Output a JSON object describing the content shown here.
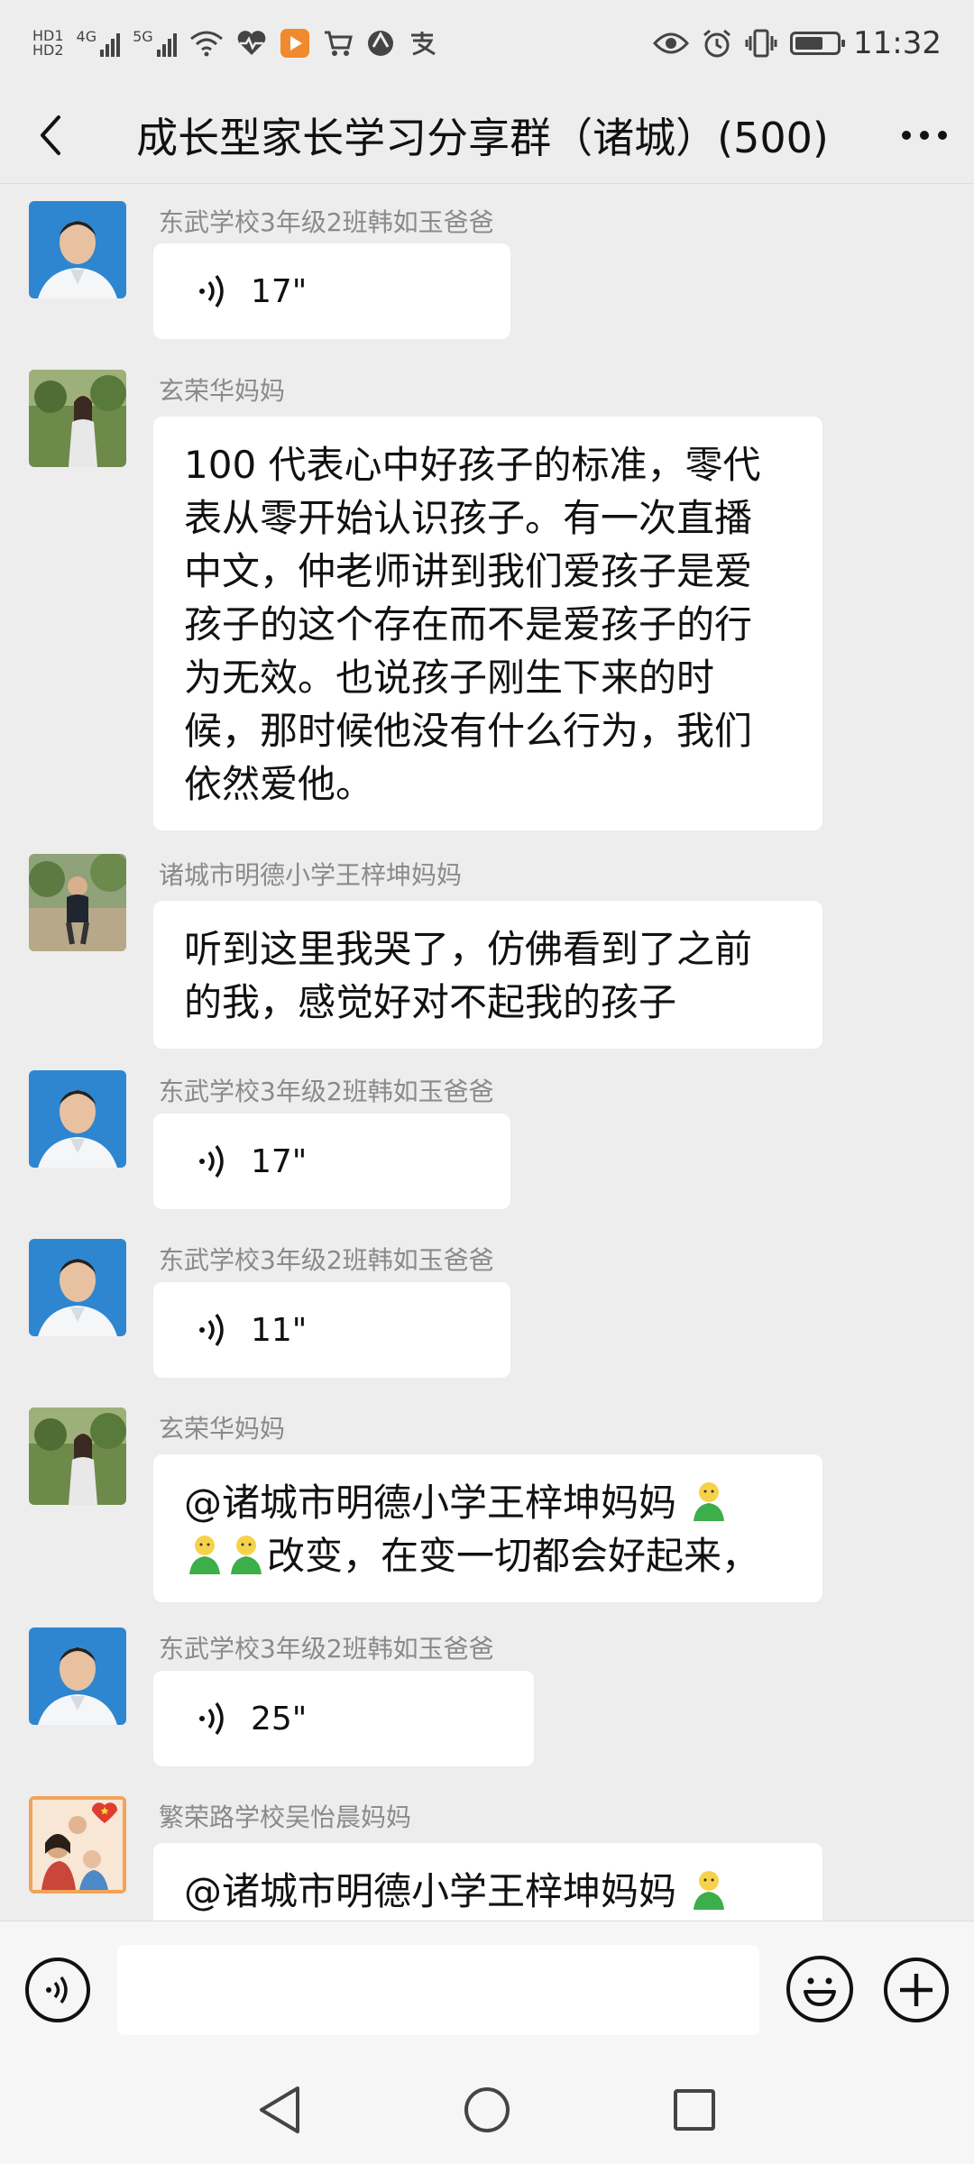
{
  "status_bar": {
    "hd1": "HD1",
    "hd2": "HD2",
    "net1": "4G",
    "net2": "5G",
    "time": "11:32",
    "icons": [
      "hd-icon",
      "signal-icon",
      "wifi-icon",
      "heart-rate-icon",
      "video-app-icon",
      "cart-icon",
      "browser-icon",
      "alipay-icon",
      "eye-icon",
      "alarm-icon",
      "vibrate-icon",
      "battery-icon"
    ]
  },
  "header": {
    "title": "成长型家长学习分享群（诸城）(500)",
    "back_icon": "chevron-left-icon",
    "more_icon": "ellipsis-icon"
  },
  "messages": [
    {
      "sender": "东武学校3年级2班韩如玉爸爸",
      "type": "voice",
      "duration": "17\""
    },
    {
      "sender": "玄荣华妈妈",
      "type": "text",
      "lines": [
        "100 代表心中好孩子的标准，零代",
        "表从零开始认识孩子。有一次直播",
        "中文，仲老师讲到我们爱孩子是爱",
        "孩子的这个存在而不是爱孩子的行",
        "为无效。也说孩子刚生下来的时",
        "候，那时候他没有什么行为，我们",
        "依然爱他。"
      ]
    },
    {
      "sender": "诸城市明德小学王梓坤妈妈",
      "type": "text",
      "lines": [
        "听到这里我哭了，仿佛看到了之前",
        "的我，感觉好对不起我的孩子"
      ]
    },
    {
      "sender": "东武学校3年级2班韩如玉爸爸",
      "type": "voice",
      "duration": "17\""
    },
    {
      "sender": "东武学校3年级2班韩如玉爸爸",
      "type": "voice",
      "duration": "11\""
    },
    {
      "sender": "玄荣华妈妈",
      "type": "text",
      "line1": "@诸城市明德小学王梓坤妈妈",
      "line2": "改变，在变一切都会好起来，"
    },
    {
      "sender": "东武学校3年级2班韩如玉爸爸",
      "type": "voice",
      "duration": "25\""
    },
    {
      "sender": "繁荣路学校吴怡晨妈妈",
      "type": "text",
      "line1": "@诸城市明德小学王梓坤妈妈"
    }
  ],
  "input": {
    "placeholder": "",
    "voice_icon": "voice-toggle-icon",
    "emoji_icon": "smiley-icon",
    "plus_icon": "plus-icon"
  },
  "colors": {
    "background": "#ededed",
    "bubble": "#ffffff",
    "sender_text": "#8a8a8a"
  }
}
